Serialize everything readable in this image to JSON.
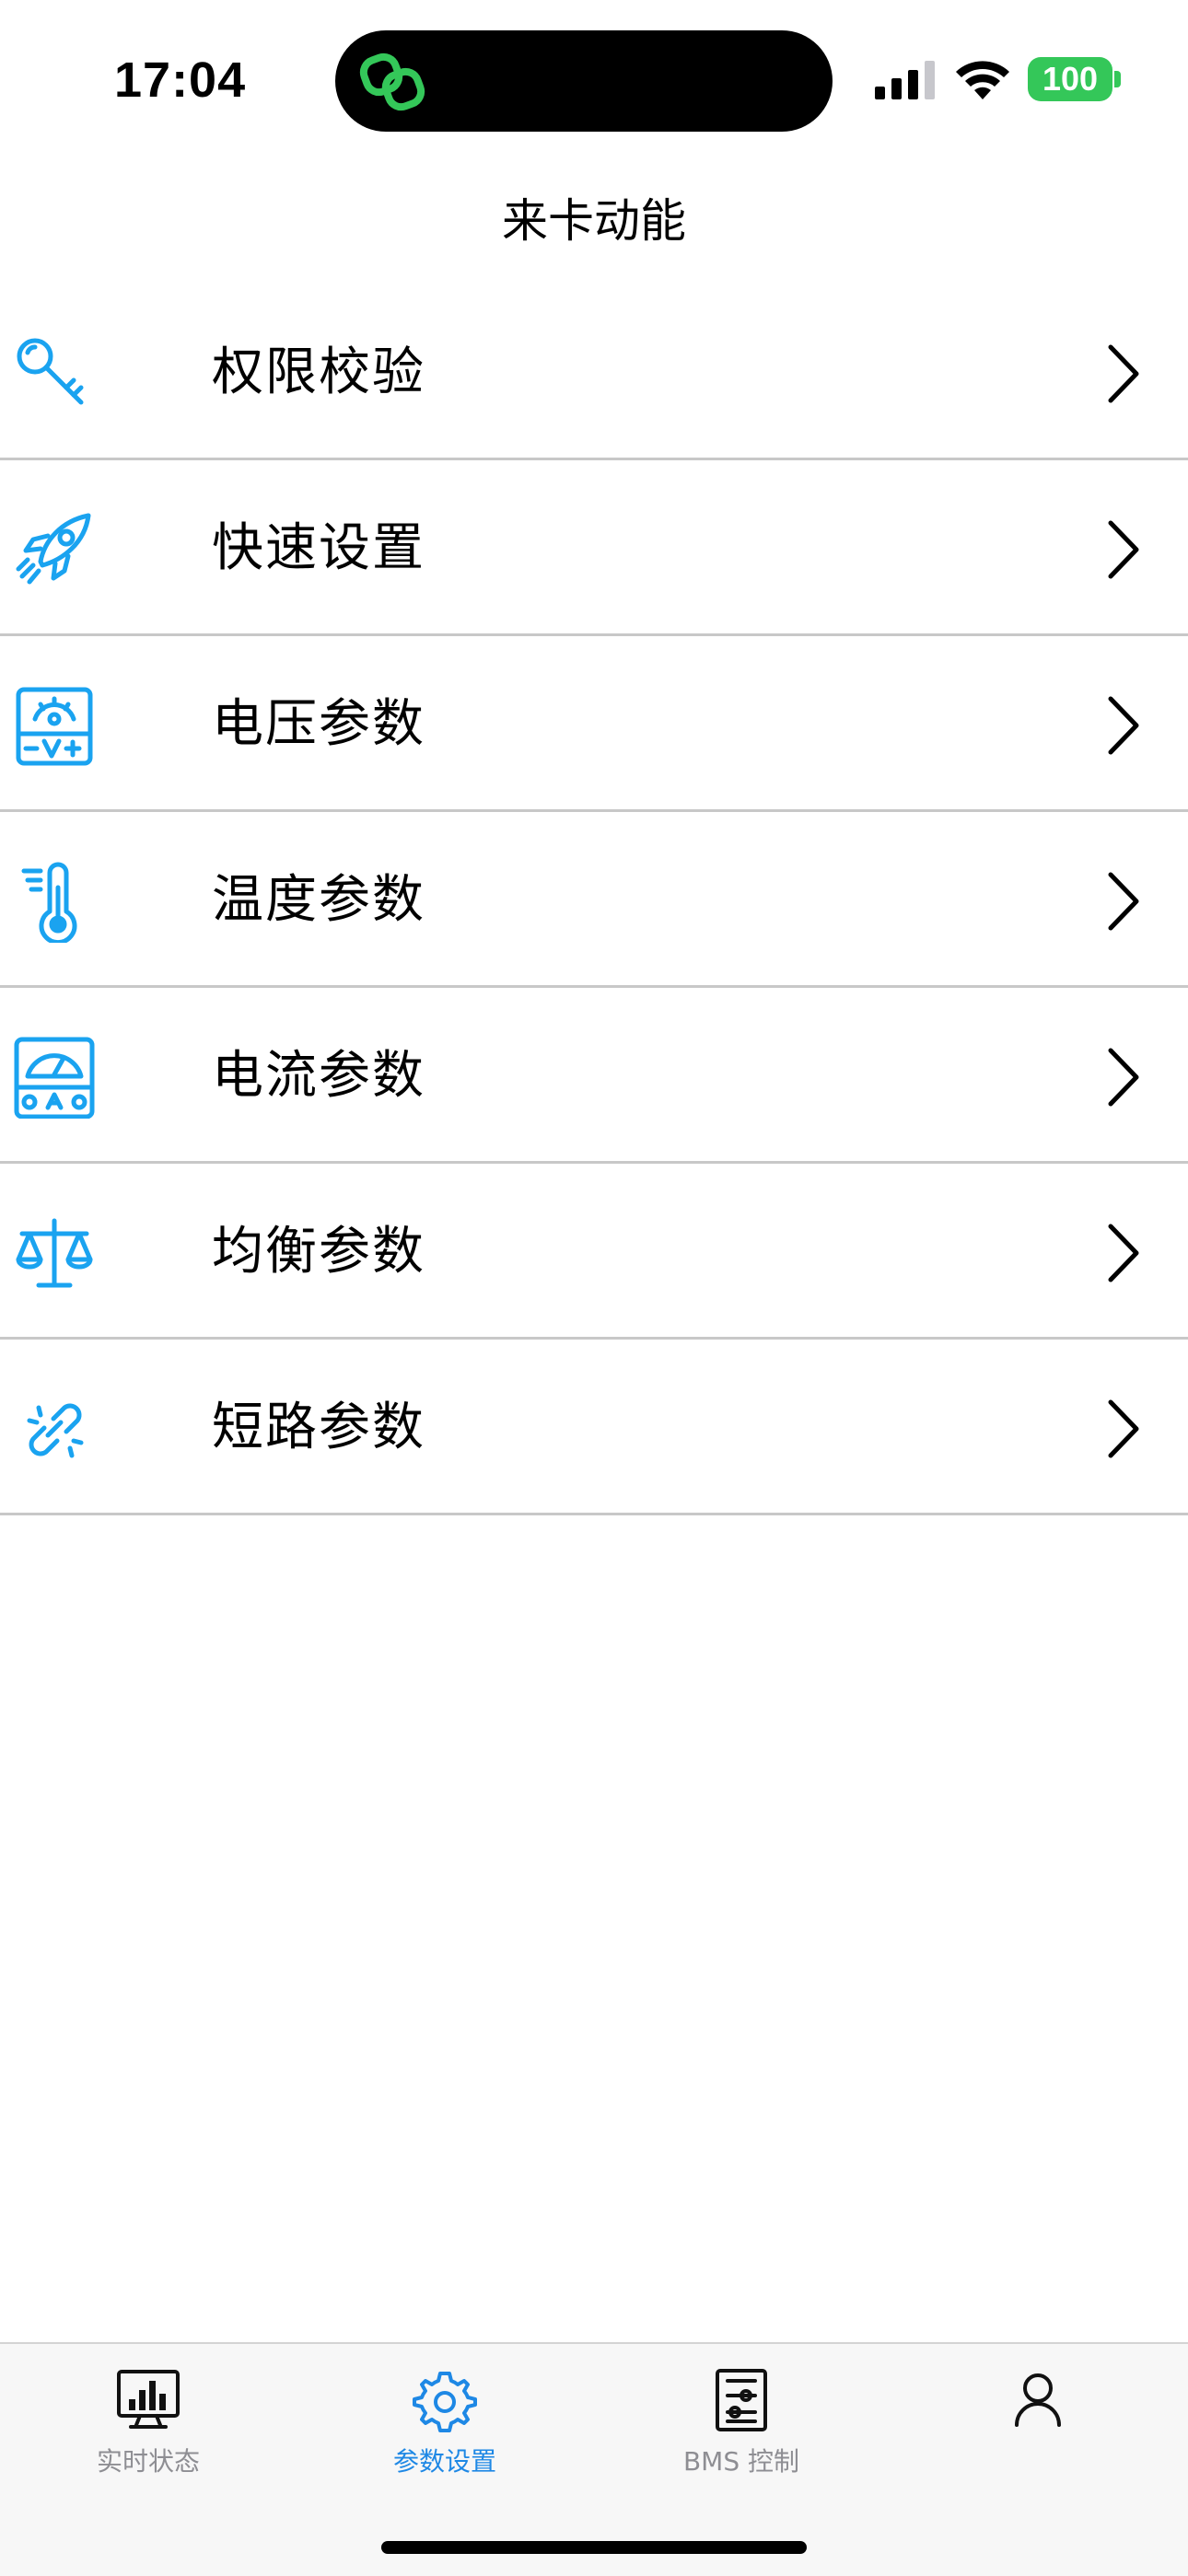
{
  "status_bar": {
    "time": "17:04",
    "battery": "100",
    "icons": [
      "link-app-icon",
      "cellular-signal-icon",
      "wifi-icon",
      "battery-icon"
    ]
  },
  "nav": {
    "title": "来卡动能"
  },
  "colors": {
    "accent": "#1e88e5",
    "icon_blue": "#1aa3f0",
    "battery_green": "#34c759",
    "divider": "#c8c8c8",
    "tab_inactive": "#8e8e93"
  },
  "menu": {
    "items": [
      {
        "label": "权限校验",
        "icon": "key-icon"
      },
      {
        "label": "快速设置",
        "icon": "rocket-icon"
      },
      {
        "label": "电压参数",
        "icon": "voltmeter-icon"
      },
      {
        "label": "温度参数",
        "icon": "thermometer-icon"
      },
      {
        "label": "电流参数",
        "icon": "ammeter-icon"
      },
      {
        "label": "均衡参数",
        "icon": "balance-scale-icon"
      },
      {
        "label": "短路参数",
        "icon": "broken-link-icon"
      }
    ],
    "chevron_icon": "chevron-right-icon"
  },
  "tab_bar": {
    "tabs": [
      {
        "label": "实时状态",
        "icon": "monitor-chart-icon",
        "active": false
      },
      {
        "label": "参数设置",
        "icon": "gear-icon",
        "active": true
      },
      {
        "label": "BMS 控制",
        "icon": "control-panel-icon",
        "active": false
      },
      {
        "label": "",
        "icon": "user-icon",
        "active": false
      }
    ]
  }
}
